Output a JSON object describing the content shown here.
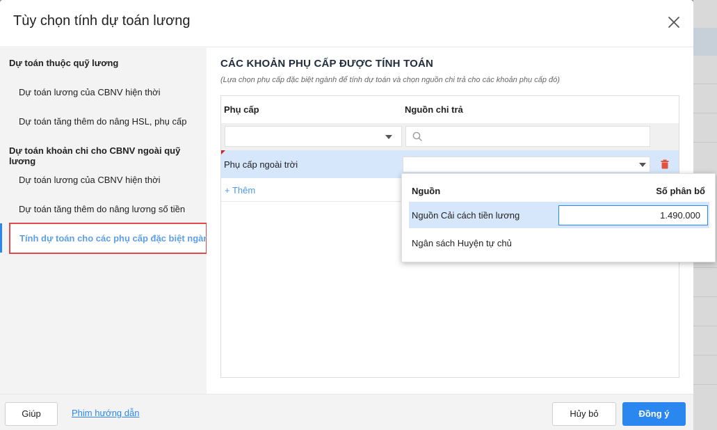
{
  "dialog": {
    "title": "Tùy chọn tính dự toán lương"
  },
  "sidebar": {
    "group1": "Dự toán thuộc quỹ lương",
    "group1_items": [
      "Dự toán lương của CBNV hiện thời",
      "Dự toán tăng thêm do nâng HSL, phụ cấp"
    ],
    "group2": "Dự toán khoản chi cho CBNV ngoài quỹ lương",
    "group2_items": [
      "Dự toán lương của CBNV hiện thời",
      "Dự toán tăng thêm do nâng lương số tiền"
    ],
    "active_item": "Tính dự toán cho các phụ cấp đặc biệt ngành"
  },
  "section": {
    "title": "CÁC KHOẢN PHỤ CẤP ĐƯỢC TÍNH TOÁN",
    "subtitle": "(Lựa chọn phụ cấp đặc biệt ngành để tính dự toán và chọn nguồn chi trả cho các khoản phụ cấp đó)"
  },
  "grid": {
    "columns": [
      "Phụ cấp",
      "Nguồn chi trả"
    ],
    "rows": [
      {
        "allowance": "Phụ cấp ngoài trời",
        "source": ""
      }
    ],
    "add_label": "+ Thêm"
  },
  "dropdown": {
    "headers": [
      "Nguồn",
      "Số phân bổ"
    ],
    "rows": [
      {
        "label": "Nguồn Cải cách tiền lương",
        "value": "1.490.000"
      },
      {
        "label": "Ngân sách Huyện tự chủ",
        "value": ""
      }
    ]
  },
  "footer": {
    "help": "Giúp",
    "video": "Phim hướng dẫn",
    "cancel": "Hủy bỏ",
    "ok": "Đồng ý"
  },
  "colors": {
    "accent": "#2b87f0",
    "highlight": "#e54848",
    "delete": "#e0533f"
  },
  "icons": [
    "close-icon",
    "chevron-down-icon",
    "search-icon",
    "trash-icon"
  ]
}
